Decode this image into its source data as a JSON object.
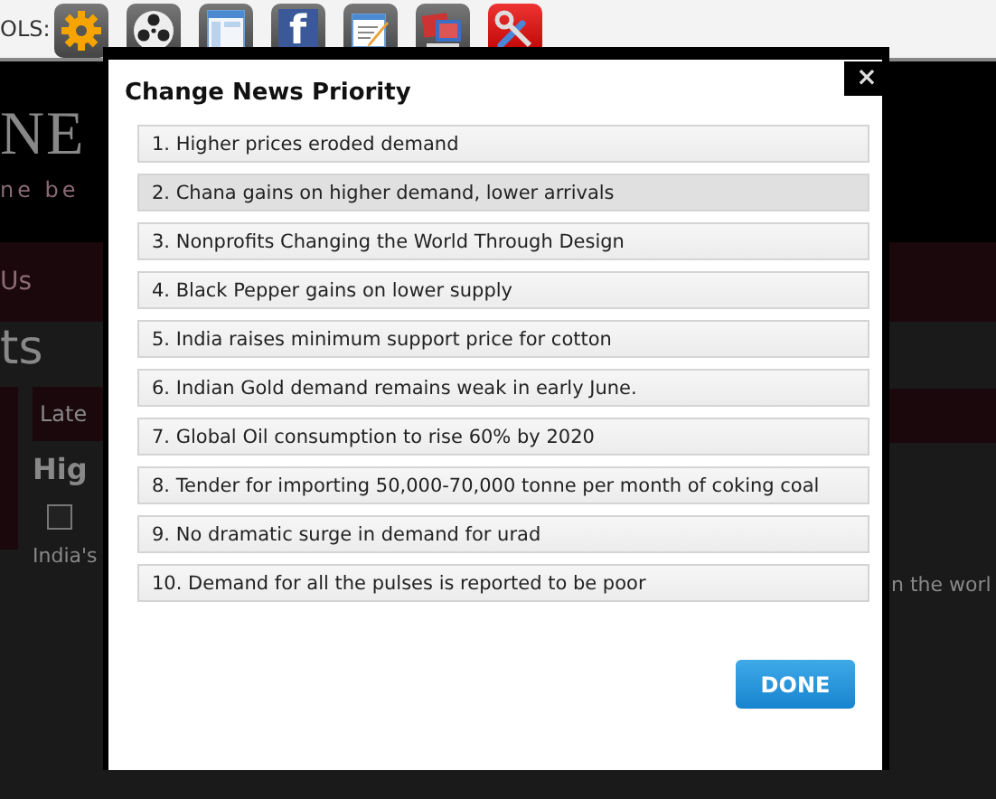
{
  "toolbar": {
    "label": "OLS:",
    "tools": [
      {
        "kind": "gear"
      },
      {
        "kind": "reel"
      },
      {
        "kind": "window"
      },
      {
        "kind": "social",
        "glyph": "f"
      },
      {
        "kind": "notepad"
      },
      {
        "kind": "photos"
      },
      {
        "kind": "tools"
      }
    ]
  },
  "background_page": {
    "logo": "NE",
    "tagline": "ne be",
    "nav_item": "Us",
    "heading": "ts",
    "tab": "Late",
    "article_title": "Hig",
    "article_text": "India's",
    "article_text_right": "n the worl"
  },
  "dialog": {
    "title": "Change News Priority",
    "close": "×",
    "items": [
      {
        "label": "1. Higher prices eroded demand",
        "selected": false
      },
      {
        "label": "2. Chana gains on higher demand, lower arrivals",
        "selected": true
      },
      {
        "label": "3. Nonprofits Changing the World Through Design",
        "selected": false
      },
      {
        "label": "4. Black Pepper gains on lower supply",
        "selected": false
      },
      {
        "label": "5. India raises minimum support price for cotton",
        "selected": false
      },
      {
        "label": "6. Indian Gold demand remains weak in early June.",
        "selected": false
      },
      {
        "label": "7. Global Oil consumption to rise 60% by 2020",
        "selected": false
      },
      {
        "label": "8. Tender for importing 50,000-70,000 tonne per month of coking coal",
        "selected": false
      },
      {
        "label": "9. No dramatic surge in demand for urad",
        "selected": false
      },
      {
        "label": "10. Demand for all the pulses is reported to be poor",
        "selected": false
      }
    ],
    "done_button": "DONE"
  }
}
